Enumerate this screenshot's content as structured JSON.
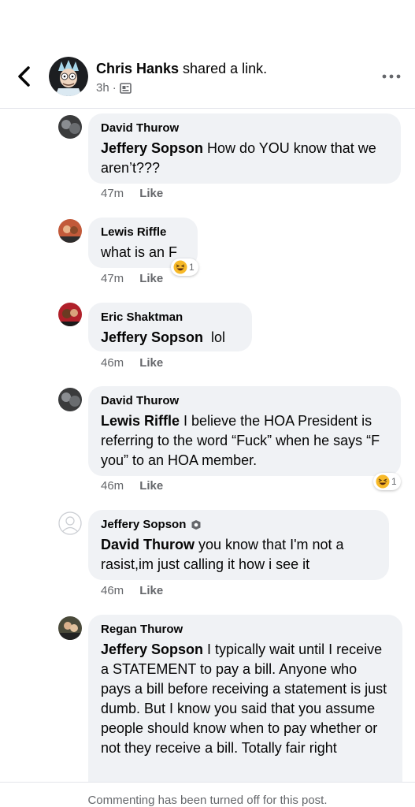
{
  "header": {
    "poster_name": "Chris Hanks",
    "action_text": " shared a link.",
    "time": "3h",
    "separator": "·"
  },
  "comments": [
    {
      "author": "David Thurow",
      "mention": "Jeffery Sopson",
      "text": " How do YOU know that we aren’t???",
      "time": "47m",
      "like": "Like"
    },
    {
      "author": "Lewis Riffle",
      "mention": "",
      "text": "what is an F",
      "time": "47m",
      "like": "Like",
      "reaction_count": "1"
    },
    {
      "author": "Eric Shaktman",
      "mention": "Jeffery Sopson",
      "text": "  lol",
      "time": "46m",
      "like": "Like"
    },
    {
      "author": "David Thurow",
      "mention": "Lewis Riffle",
      "text": " I believe the HOA President is referring to the word “Fuck” when he says “F you” to an HOA member.",
      "time": "46m",
      "like": "Like",
      "reaction_count": "1"
    },
    {
      "author": "Jeffery Sopson",
      "mention": "David Thurow",
      "text": " you know that I'm not a rasist,im just calling it how i see it",
      "time": "46m",
      "like": "Like"
    },
    {
      "author": "Regan Thurow",
      "mention": "Jeffery Sopson",
      "text": " I typically wait until I receive a STATEMENT to pay a bill. Anyone who pays a bill before receiving a statement is just dumb. But I know you said that you assume people should know when to pay whether or not they receive a bill. Totally fair right",
      "time": "",
      "like": ""
    }
  ],
  "footer": {
    "text": "Commenting has been turned off for this post."
  },
  "colors": {
    "bubble": "#f0f2f5",
    "meta": "#65676b",
    "text": "#050505"
  },
  "icons": [
    "back-chevron-icon",
    "privacy-icon",
    "more-icon",
    "haha-reaction-icon",
    "moderator-badge-icon"
  ]
}
